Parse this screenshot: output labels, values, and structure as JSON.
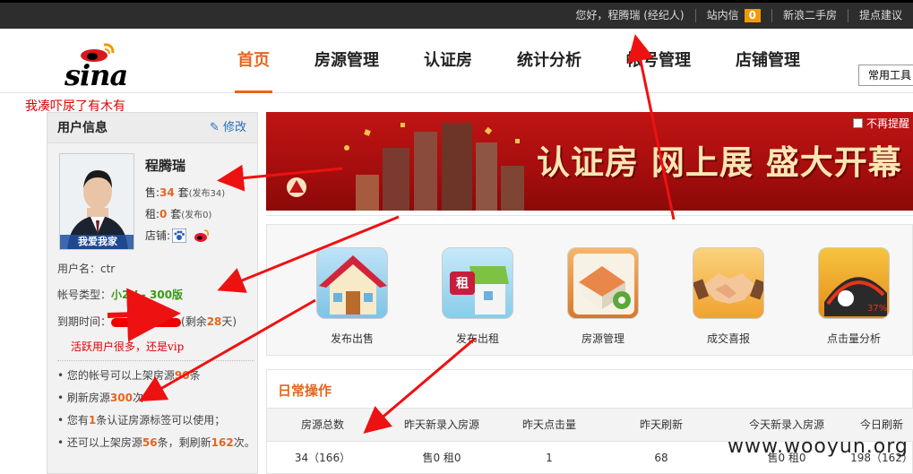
{
  "topbar": {
    "greeting": "您好，程腾瑞 (经纪人)",
    "inbox_label": "站内信",
    "inbox_count": "0",
    "secondhand": "新浪二手房",
    "feedback": "提点建议"
  },
  "logo": {
    "text": "sina"
  },
  "nav": {
    "items": [
      {
        "label": "首页"
      },
      {
        "label": "房源管理"
      },
      {
        "label": "认证房"
      },
      {
        "label": "统计分析"
      },
      {
        "label": "帐号管理"
      },
      {
        "label": "店铺管理"
      }
    ],
    "tools_label": "常用工具"
  },
  "annotation_top": "我凑吓尿了有木有",
  "annotation_vip": "活跃用户很多，还是vip",
  "sidebar": {
    "title": "用户信息",
    "edit": "修改",
    "avatar_caption": "我爱我家",
    "name": "程腾瑞",
    "sale_prefix": "售:",
    "sale_num": "34",
    "sale_unit": "套",
    "sale_pub": "(发布34)",
    "rent_prefix": "租:",
    "rent_num": "0",
    "rent_unit": "套",
    "rent_pub": "(发布0)",
    "shop_label": "店铺:",
    "username": "用户名：ctr",
    "account_type_label": "帐号类型：",
    "account_type": "小2V - 300版",
    "expire_label": "到期时间：",
    "expire_remain_prefix": "(剩余",
    "expire_remain_days": "28",
    "expire_remain_suffix": "天)",
    "tips": [
      {
        "pre": "您的帐号可以上架房源",
        "num": "90",
        "post": "条"
      },
      {
        "pre": "刷新房源",
        "num": "300",
        "post": "次"
      },
      {
        "pre": "您有",
        "num": "1",
        "post": "条认证房源标签可以使用；"
      },
      {
        "pre": "还可以上架房源",
        "num": "56",
        "post": "条，剩刷新",
        "num2": "162",
        "post2": "次。"
      }
    ]
  },
  "banner": {
    "title": "认证房 网上展 盛大开幕",
    "dismiss": "不再提醒"
  },
  "quick": {
    "items": [
      {
        "label": "发布出售",
        "icon": "house-icon"
      },
      {
        "label": "发布出租",
        "icon": "rent-house-icon"
      },
      {
        "label": "房源管理",
        "icon": "house-gear-icon"
      },
      {
        "label": "成交喜报",
        "icon": "handshake-icon"
      },
      {
        "label": "点击量分析",
        "icon": "chart-icon"
      }
    ]
  },
  "daily": {
    "title": "日常操作",
    "headers": [
      "房源总数",
      "昨天新录入房源",
      "昨天点击量",
      "昨天刷新",
      "今天新录入房源",
      "今日刷新"
    ],
    "values": [
      "34（166）",
      "售0 租0",
      "1",
      "68",
      "售0 租0",
      "198（162）"
    ]
  },
  "watermark": "www.wooyun.org",
  "colors": {
    "accent": "#e5651f",
    "banner_red": "#b81111",
    "annotation_red": "#dd0000"
  }
}
